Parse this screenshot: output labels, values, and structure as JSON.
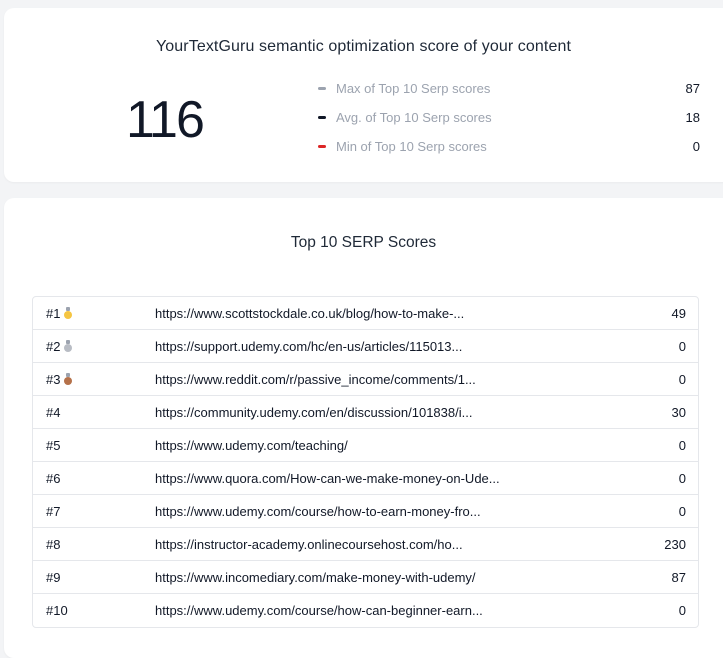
{
  "summary": {
    "title": "YourTextGuru semantic optimization score of your content",
    "score": "116",
    "stats": [
      {
        "label": "Max of Top 10 Serp scores",
        "value": "87",
        "color": "#9ca3af"
      },
      {
        "label": "Avg. of Top 10 Serp scores",
        "value": "18",
        "color": "#111827"
      },
      {
        "label": "Min of Top 10 Serp scores",
        "value": "0",
        "color": "#dc2626"
      }
    ]
  },
  "serp": {
    "title": "Top 10 SERP Scores",
    "rows": [
      {
        "rank": "#1",
        "medal": "gold-medal-icon",
        "medal_color": "#f5c542",
        "url": "https://www.scottstockdale.co.uk/blog/how-to-make-...",
        "score": "49"
      },
      {
        "rank": "#2",
        "medal": "silver-medal-icon",
        "medal_color": "#b8bcc4",
        "url": "https://support.udemy.com/hc/en-us/articles/115013...",
        "score": "0"
      },
      {
        "rank": "#3",
        "medal": "bronze-medal-icon",
        "medal_color": "#b5714a",
        "url": "https://www.reddit.com/r/passive_income/comments/1...",
        "score": "0"
      },
      {
        "rank": "#4",
        "url": "https://community.udemy.com/en/discussion/101838/i...",
        "score": "30"
      },
      {
        "rank": "#5",
        "url": "https://www.udemy.com/teaching/",
        "score": "0"
      },
      {
        "rank": "#6",
        "url": "https://www.quora.com/How-can-we-make-money-on-Ude...",
        "score": "0"
      },
      {
        "rank": "#7",
        "url": "https://www.udemy.com/course/how-to-earn-money-fro...",
        "score": "0"
      },
      {
        "rank": "#8",
        "url": "https://instructor-academy.onlinecoursehost.com/ho...",
        "score": "230"
      },
      {
        "rank": "#9",
        "url": "https://www.incomediary.com/make-money-with-udemy/",
        "score": "87"
      },
      {
        "rank": "#10",
        "url": "https://www.udemy.com/course/how-can-beginner-earn...",
        "score": "0"
      }
    ]
  }
}
